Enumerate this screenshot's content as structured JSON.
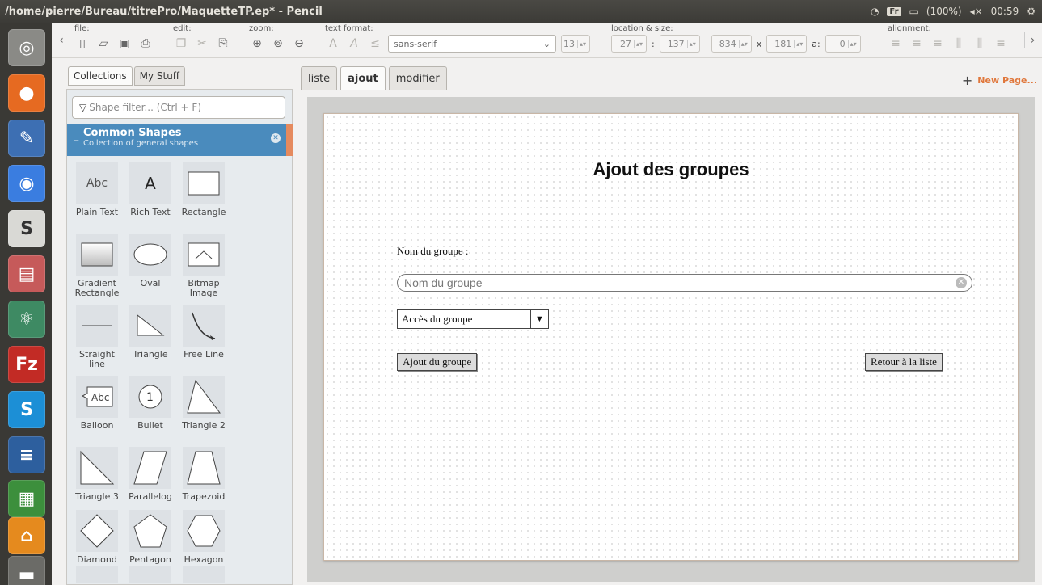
{
  "window": {
    "title": "/home/pierre/Bureau/titrePro/MaquetteTP.ep* - Pencil"
  },
  "tray": {
    "keyboard": "Fr",
    "battery": "(100%)",
    "clock": "00:59"
  },
  "toolbar": {
    "file_label": "file:",
    "edit_label": "edit:",
    "zoom_label": "zoom:",
    "text_format_label": "text format:",
    "font_family": "sans-serif",
    "font_size": "13",
    "location_label": "location & size:",
    "x": "27",
    "y": "137",
    "width": "834",
    "height": "181",
    "colon_sep": ":",
    "times_sep": "x",
    "angle_label": "a:",
    "angle": "0",
    "alignment_label": "alignment:"
  },
  "panel": {
    "tabs": [
      "Collections",
      "My Stuff"
    ],
    "filter_placeholder": "Shape filter... (Ctrl + F)",
    "collection_title": "Common Shapes",
    "collection_subtitle": "Collection of general shapes",
    "shapes": [
      {
        "label": "Plain Text",
        "glyph": "Abc"
      },
      {
        "label": "Rich Text",
        "glyph": "A"
      },
      {
        "label": "Rectangle"
      },
      {
        "label": "Gradient Rectangle"
      },
      {
        "label": "Oval"
      },
      {
        "label": "Bitmap Image"
      },
      {
        "label": "Straight line"
      },
      {
        "label": "Triangle"
      },
      {
        "label": "Free Line"
      },
      {
        "label": "Balloon",
        "glyph": "Abc"
      },
      {
        "label": "Bullet",
        "glyph": "1"
      },
      {
        "label": "Triangle 2"
      },
      {
        "label": "Triangle 3"
      },
      {
        "label": "Parallelog"
      },
      {
        "label": "Trapezoid"
      },
      {
        "label": "Diamond"
      },
      {
        "label": "Pentagon"
      },
      {
        "label": "Hexagon"
      }
    ]
  },
  "pages": {
    "tabs": [
      "liste",
      "ajout",
      "modifier"
    ],
    "active": "ajout",
    "new_page": "New Page..."
  },
  "mockup": {
    "title": "Ajout des groupes",
    "name_label": "Nom du groupe :",
    "name_placeholder": "Nom du groupe",
    "access_select": "Accès du groupe",
    "add_button": "Ajout du groupe",
    "back_button": "Retour à la liste"
  },
  "colors": {
    "collection_header": "#4a8bbd",
    "new_page_accent": "#e0773b",
    "titlebar": "#3c3b37"
  }
}
